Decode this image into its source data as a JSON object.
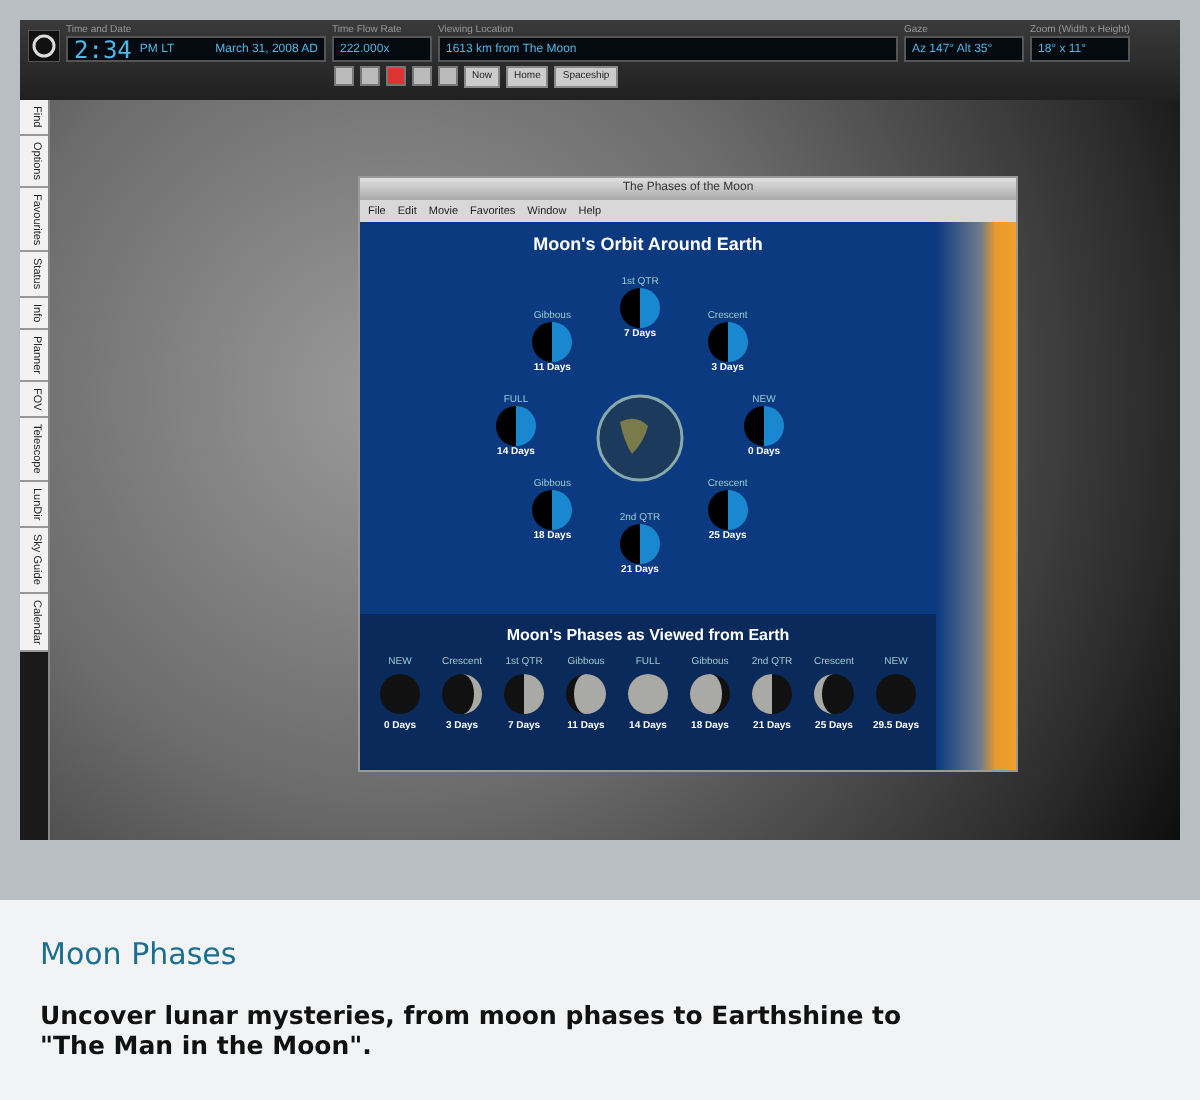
{
  "toolbar": {
    "fields": [
      {
        "label": "Time and Date",
        "value": "2:34",
        "suffix": "PM LT",
        "extra": "March 31, 2008 AD"
      },
      {
        "label": "Time Flow Rate",
        "value": "222.000x"
      },
      {
        "label": "Viewing Location",
        "value": "1613 km from The Moon"
      },
      {
        "label": "Gaze",
        "value": "Az 147° Alt 35°"
      },
      {
        "label": "Zoom (Width x Height)",
        "value": "18° x 11°"
      }
    ],
    "buttons": [
      "Now",
      "Home",
      "Spaceship"
    ]
  },
  "side_tabs": [
    {
      "label": "Find"
    },
    {
      "label": "Options"
    },
    {
      "label": "Favourites"
    },
    {
      "label": "Status"
    },
    {
      "label": "Info"
    },
    {
      "label": "Planner"
    },
    {
      "label": "FOV"
    },
    {
      "label": "Telescope"
    },
    {
      "label": "LunDir"
    },
    {
      "label": "Sky Guide"
    },
    {
      "label": "Calendar"
    }
  ],
  "window": {
    "title": "The Phases of the Moon",
    "menu": [
      "File",
      "Edit",
      "Movie",
      "Favorites",
      "Window",
      "Help"
    ],
    "orbit_title": "Moon's Orbit Around Earth",
    "orbit": [
      {
        "name": "NEW",
        "days": "0 Days"
      },
      {
        "name": "Crescent",
        "days": "3 Days"
      },
      {
        "name": "1st QTR",
        "days": "7 Days"
      },
      {
        "name": "Gibbous",
        "days": "11 Days"
      },
      {
        "name": "FULL",
        "days": "14 Days"
      },
      {
        "name": "Gibbous",
        "days": "18 Days"
      },
      {
        "name": "2nd QTR",
        "days": "21 Days"
      },
      {
        "name": "Crescent",
        "days": "25 Days"
      }
    ],
    "phases_title": "Moon's Phases as Viewed from Earth",
    "phases": [
      {
        "name": "NEW",
        "days": "0 Days"
      },
      {
        "name": "Crescent",
        "days": "3 Days"
      },
      {
        "name": "1st QTR",
        "days": "7 Days"
      },
      {
        "name": "Gibbous",
        "days": "11 Days"
      },
      {
        "name": "FULL",
        "days": "14 Days"
      },
      {
        "name": "Gibbous",
        "days": "18 Days"
      },
      {
        "name": "2nd QTR",
        "days": "21 Days"
      },
      {
        "name": "Crescent",
        "days": "25 Days"
      },
      {
        "name": "NEW",
        "days": "29.5 Days"
      }
    ]
  },
  "caption": {
    "title": "Moon Phases",
    "text": "Uncover lunar mysteries, from moon phases to Earthshine to \"The Man in the Moon\"."
  }
}
